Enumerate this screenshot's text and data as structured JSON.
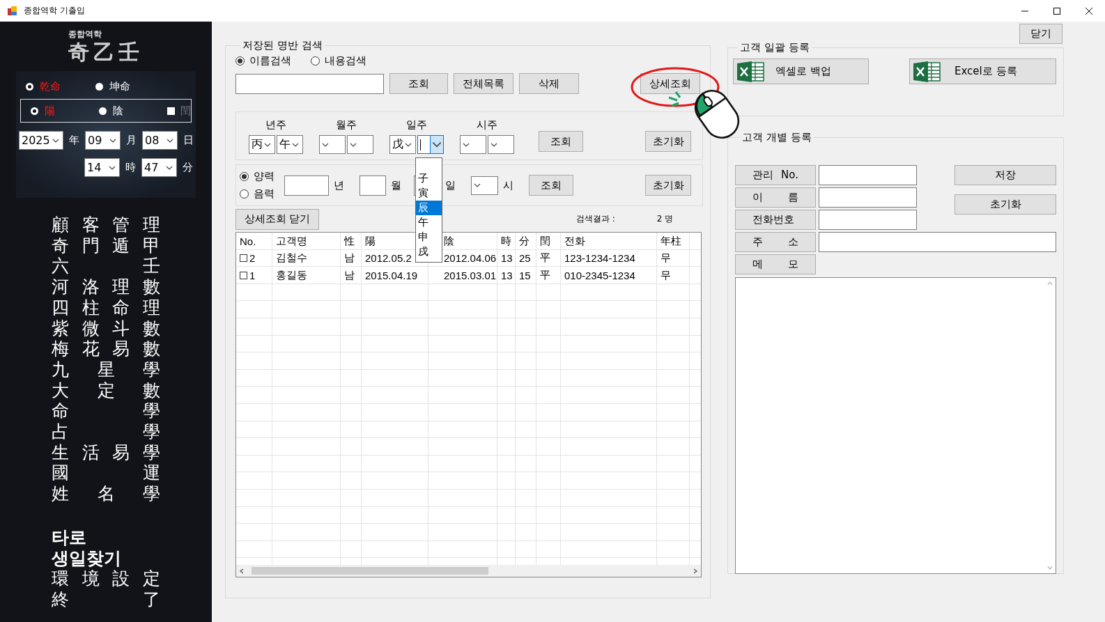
{
  "window": {
    "title": "종합역학 기출입"
  },
  "sidebar": {
    "logo_caption": "종합역학",
    "logo_title": "奇乙壬",
    "gender_options": [
      {
        "label": "乾命",
        "selected": true
      },
      {
        "label": "坤命",
        "selected": false
      }
    ],
    "yinyang_options": [
      {
        "label": "陽",
        "selected": true
      },
      {
        "label": "陰",
        "selected": false
      }
    ],
    "leap": {
      "label": "閏",
      "checked": false
    },
    "date_fields": [
      {
        "value": "2025",
        "unit": "年"
      },
      {
        "value": "09",
        "unit": "月"
      },
      {
        "value": "08",
        "unit": "日"
      }
    ],
    "time_fields": [
      {
        "value": "14",
        "unit": "時"
      },
      {
        "value": "47",
        "unit": "分"
      }
    ],
    "menu_items": [
      {
        "label": "顧客管理",
        "bold": false
      },
      {
        "label": "奇門遁甲",
        "bold": false
      },
      {
        "label": "六壬",
        "bold": false
      },
      {
        "label": "河洛理數",
        "bold": false
      },
      {
        "label": "四柱命理",
        "bold": false
      },
      {
        "label": "紫微斗數",
        "bold": false
      },
      {
        "label": "梅花易數",
        "bold": false
      },
      {
        "label": "九星學",
        "bold": false
      },
      {
        "label": "大定數",
        "bold": false
      },
      {
        "label": "命學",
        "bold": false
      },
      {
        "label": "占學",
        "bold": false
      },
      {
        "label": "生活易學",
        "bold": false
      },
      {
        "label": "國運",
        "bold": false
      },
      {
        "label": "姓名學",
        "bold": false
      }
    ],
    "menu_items_2": [
      {
        "label": "타로",
        "bold": true
      },
      {
        "label": "생일찾기",
        "bold": true
      },
      {
        "label": "環境設定",
        "bold": false
      },
      {
        "label": "終了",
        "bold": false
      }
    ]
  },
  "search_group": {
    "title": "저장된 명반 검색",
    "modes": [
      {
        "label": "이름검색",
        "selected": true
      },
      {
        "label": "내용검색",
        "selected": false
      }
    ],
    "buttons": [
      "조회",
      "전체목록",
      "삭제"
    ],
    "detail_button": "상세조회",
    "pillars": [
      {
        "label": "년주",
        "stem": "丙",
        "branch": "午"
      },
      {
        "label": "월주"
      },
      {
        "label": "일주",
        "stem": "戊",
        "branch_open": true
      },
      {
        "label": "시주"
      }
    ],
    "pillar_search_button": "조회",
    "pillar_reset_button": "초기화",
    "calendars": [
      {
        "label": "양력",
        "selected": true
      },
      {
        "label": "음력",
        "selected": false
      }
    ],
    "date_units": [
      "년",
      "월",
      "일",
      "시"
    ],
    "date_search_button": "조회",
    "date_reset_button": "초기화",
    "close_detail_button": "상세조회 닫기",
    "result_label": "검색결과 :",
    "result_count": "2 명",
    "table": {
      "columns": [
        "No.",
        "고객명",
        "性",
        "陽",
        "陰",
        "時",
        "分",
        "閏",
        "전화",
        "年柱"
      ],
      "rows": [
        {
          "checked": false,
          "cells": [
            "2",
            "김철수",
            "남",
            "2012.05.2",
            "2012.04.06",
            "13",
            "25",
            "平",
            "123-1234-1234",
            "무"
          ]
        },
        {
          "checked": false,
          "cells": [
            "1",
            "홍길동",
            "남",
            "2015.04.19",
            "2015.03.01",
            "13",
            "15",
            "平",
            "010-2345-1234",
            "무"
          ]
        }
      ]
    },
    "dropdown": [
      {
        "label": "子",
        "selected": false
      },
      {
        "label": "寅",
        "selected": false
      },
      {
        "label": "辰",
        "selected": true
      },
      {
        "label": "午",
        "selected": false
      },
      {
        "label": "申",
        "selected": false
      },
      {
        "label": "戌",
        "selected": false
      }
    ]
  },
  "right": {
    "close_button": "닫기",
    "bulk_group": {
      "title": "고객 일괄 등록",
      "buttons": [
        "엑셀로 백업",
        "Excel로 등록"
      ]
    },
    "single_group": {
      "title": "고객 개별 등록",
      "fields": [
        {
          "label": "관리 No.",
          "kind": "short"
        },
        {
          "label": "이 름",
          "kind": "short"
        },
        {
          "label": "전화번호",
          "kind": "short"
        },
        {
          "label": "주 소",
          "kind": "long"
        }
      ],
      "save_button": "저장",
      "reset_button": "초기화",
      "memo_label": "메 모"
    }
  }
}
